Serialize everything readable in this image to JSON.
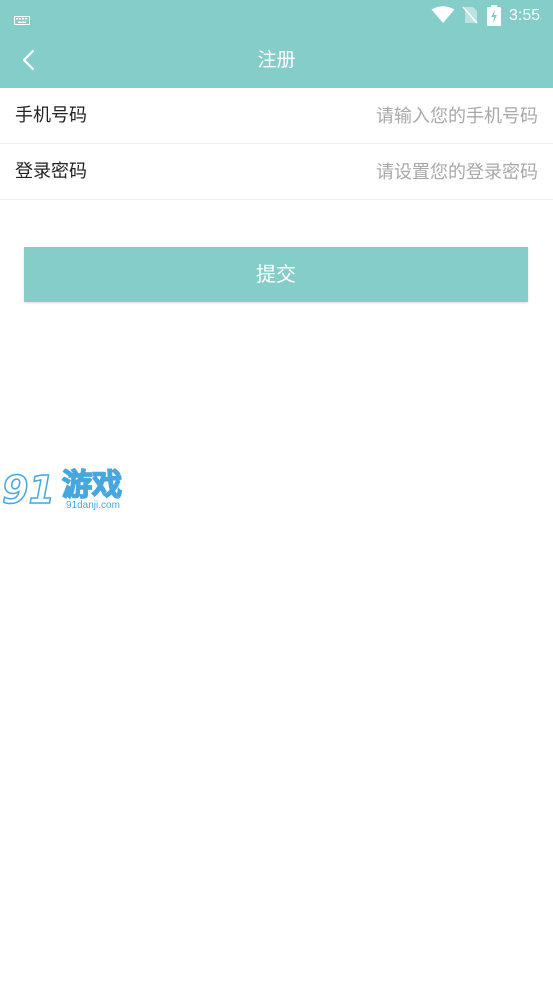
{
  "status_bar": {
    "time": "3:55",
    "icons": [
      "keyboard-icon",
      "wifi-icon",
      "no-sim-icon",
      "battery-charging-icon"
    ]
  },
  "header": {
    "title": "注册",
    "back_icon": "chevron-left-icon"
  },
  "form": {
    "phone": {
      "label": "手机号码",
      "placeholder": "请输入您的手机号码",
      "value": ""
    },
    "password": {
      "label": "登录密码",
      "placeholder": "请设置您的登录密码",
      "value": ""
    },
    "submit_label": "提交"
  },
  "watermark": {
    "number": "91",
    "text": "游戏",
    "url": "91danji.com"
  },
  "colors": {
    "accent": "#84cdc9",
    "white": "#ffffff",
    "label_text": "#222222",
    "placeholder_text": "#a8a8a8",
    "divider": "#eeeeee",
    "watermark_blue": "#46a6de"
  }
}
